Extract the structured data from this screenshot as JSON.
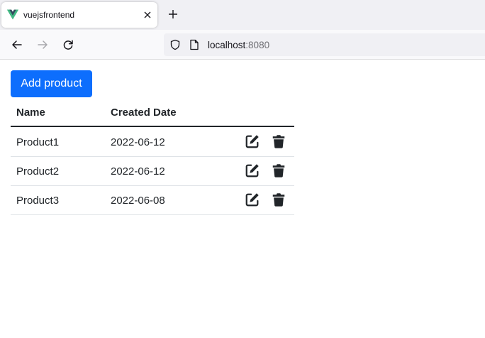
{
  "browser": {
    "tab": {
      "title": "vuejsfrontend",
      "favicon": "vue-logo-icon"
    },
    "url": {
      "host": "localhost",
      "port": ":8080"
    }
  },
  "page": {
    "add_button_label": "Add product",
    "table": {
      "headers": [
        "Name",
        "Created Date"
      ],
      "rows": [
        {
          "name": "Product1",
          "created": "2022-06-12"
        },
        {
          "name": "Product2",
          "created": "2022-06-12"
        },
        {
          "name": "Product3",
          "created": "2022-06-08"
        }
      ]
    }
  },
  "colors": {
    "primary": "#0d6efd",
    "text": "#212529",
    "tabstrip": "#f0f0f4",
    "toolbar": "#f9f9fb",
    "vue_green": "#41b883",
    "vue_dark": "#34495e"
  }
}
